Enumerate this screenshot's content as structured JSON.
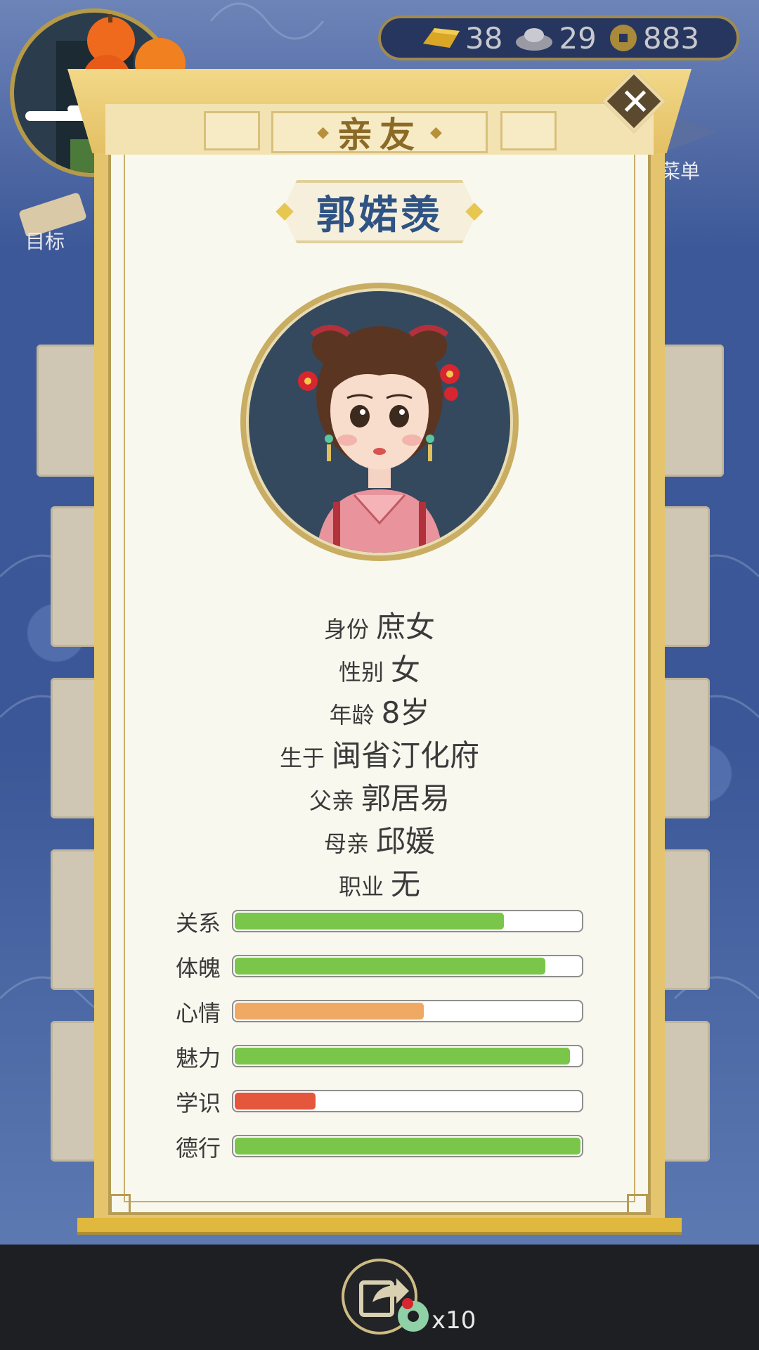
{
  "currency": [
    {
      "icon": "gold-ingot-icon",
      "value": "38"
    },
    {
      "icon": "silver-ingot-icon",
      "value": "29"
    },
    {
      "icon": "copper-coin-icon",
      "value": "883"
    }
  ],
  "side_buttons": {
    "goal_label": "目标",
    "menu_label": "菜单"
  },
  "panel": {
    "title": "亲友",
    "close_label": "✕"
  },
  "person": {
    "name": "郭婼羡",
    "info": [
      {
        "label": "身份",
        "value": "庶女"
      },
      {
        "label": "性别",
        "value": "女"
      },
      {
        "label": "年龄",
        "value": "8岁"
      },
      {
        "label": "生于",
        "value": "闽省汀化府"
      },
      {
        "label": "父亲",
        "value": "郭居易"
      },
      {
        "label": "母亲",
        "value": "邱媛"
      },
      {
        "label": "职业",
        "value": "无"
      }
    ],
    "stats": [
      {
        "label": "关系",
        "percent": 78,
        "color": "#79c64a"
      },
      {
        "label": "体魄",
        "percent": 90,
        "color": "#79c64a"
      },
      {
        "label": "心情",
        "percent": 55,
        "color": "#f0a865"
      },
      {
        "label": "魅力",
        "percent": 97,
        "color": "#79c64a"
      },
      {
        "label": "学识",
        "percent": 24,
        "color": "#e5573c"
      },
      {
        "label": "德行",
        "percent": 100,
        "color": "#79c64a"
      }
    ]
  },
  "share": {
    "count": "x10"
  }
}
